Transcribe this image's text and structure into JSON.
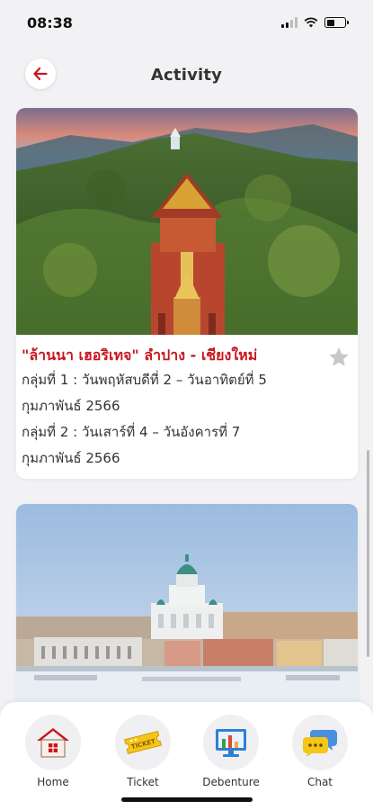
{
  "status_bar": {
    "time": "08:38",
    "icons": [
      "signal-icon",
      "wifi-icon",
      "battery-icon"
    ]
  },
  "header": {
    "title": "Activity",
    "back_icon": "arrow-left-icon",
    "accent_color": "#c8161d"
  },
  "cards": [
    {
      "image": "aerial-mountain-temple-photo",
      "title": "\"ล้านนา เฮอริเทจ\" ลำปาง - เชียงใหม่",
      "lines": [
        "กลุ่มที่ 1 : วันพฤหัสบดีที่ 2 – วันอาทิตย์ที่ 5",
        "กุมภาพันธ์ 2566",
        "กลุ่มที่ 2 : วันเสาร์ที่ 4 – วันอังคารที่ 7",
        "กุมภาพันธ์ 2566"
      ],
      "favorite_icon": "star-icon"
    },
    {
      "image": "helsinki-cathedral-winter-photo"
    }
  ],
  "nav": {
    "items": [
      {
        "label": "Home",
        "icon": "home-icon"
      },
      {
        "label": "Ticket",
        "icon": "ticket-icon"
      },
      {
        "label": "Debenture",
        "icon": "debenture-chart-icon"
      },
      {
        "label": "Chat",
        "icon": "chat-icon"
      }
    ]
  },
  "colors": {
    "background": "#f2f2f4",
    "card": "#ffffff",
    "title_red": "#c8161d"
  }
}
